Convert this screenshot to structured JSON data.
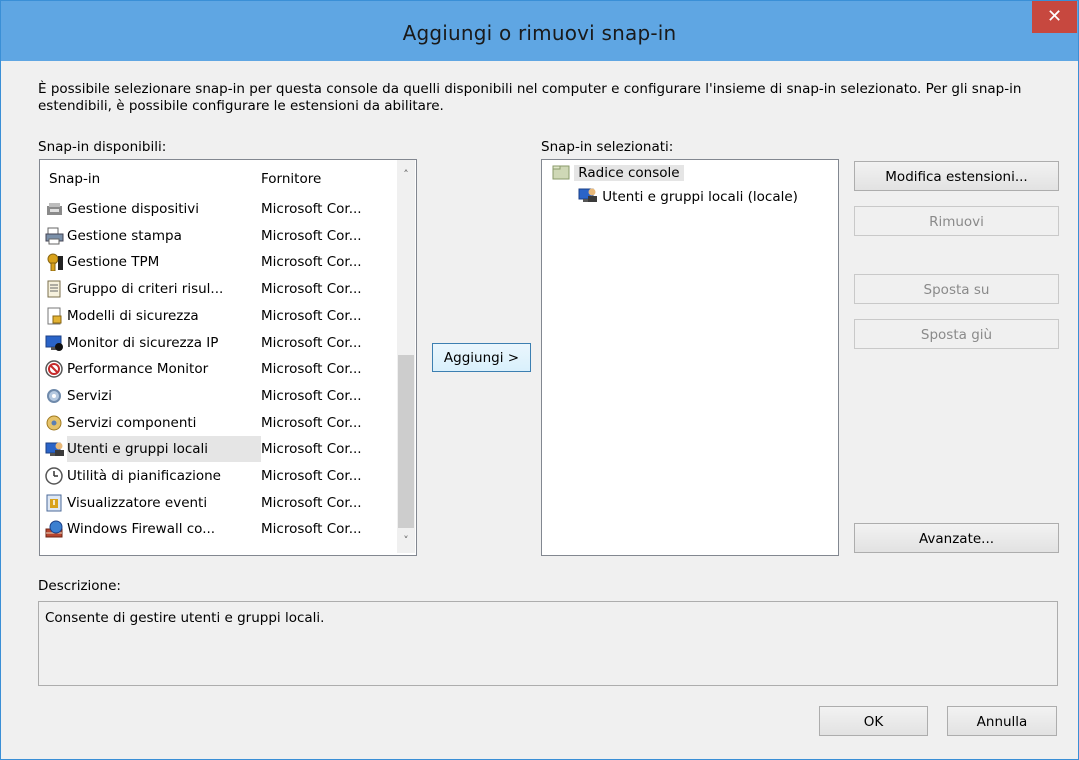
{
  "window": {
    "title": "Aggiungi o rimuovi snap-in",
    "close_glyph": "✕"
  },
  "intro_text": "È possibile selezionare snap-in per questa console da quelli disponibili nel computer e configurare l'insieme di snap-in selezionato. Per gli snap-in estendibili, è possibile configurare le estensioni da abilitare.",
  "available": {
    "label": "Snap-in disponibili:",
    "columns": [
      "Snap-in",
      "Fornitore"
    ],
    "items": [
      {
        "name": "Gestione dispositivi",
        "vendor": "Microsoft Cor...",
        "icon": "device-manager-icon",
        "selected": false
      },
      {
        "name": "Gestione stampa",
        "vendor": "Microsoft Cor...",
        "icon": "print-management-icon",
        "selected": false
      },
      {
        "name": "Gestione TPM",
        "vendor": "Microsoft Cor...",
        "icon": "tpm-key-icon",
        "selected": false
      },
      {
        "name": "Gruppo di criteri risul...",
        "vendor": "Microsoft Cor...",
        "icon": "policy-document-icon",
        "selected": false
      },
      {
        "name": "Modelli di sicurezza",
        "vendor": "Microsoft Cor...",
        "icon": "security-template-icon",
        "selected": false
      },
      {
        "name": "Monitor di sicurezza IP",
        "vendor": "Microsoft Cor...",
        "icon": "ip-security-monitor-icon",
        "selected": false
      },
      {
        "name": "Performance Monitor",
        "vendor": "Microsoft Cor...",
        "icon": "performance-monitor-icon",
        "selected": false
      },
      {
        "name": "Servizi",
        "vendor": "Microsoft Cor...",
        "icon": "services-gear-icon",
        "selected": false
      },
      {
        "name": "Servizi componenti",
        "vendor": "Microsoft Cor...",
        "icon": "component-services-icon",
        "selected": false
      },
      {
        "name": "Utenti e gruppi locali",
        "vendor": "Microsoft Cor...",
        "icon": "local-users-icon",
        "selected": true
      },
      {
        "name": "Utilità di pianificazione",
        "vendor": "Microsoft Cor...",
        "icon": "task-scheduler-clock-icon",
        "selected": false
      },
      {
        "name": "Visualizzatore eventi",
        "vendor": "Microsoft Cor...",
        "icon": "event-viewer-icon",
        "selected": false
      },
      {
        "name": "Windows Firewall co...",
        "vendor": "Microsoft Cor...",
        "icon": "firewall-icon",
        "selected": false
      }
    ]
  },
  "add_button": "Aggiungi >",
  "selected_snapins": {
    "label": "Snap-in selezionati:",
    "root": "Radice console",
    "child": "Utenti e gruppi locali (locale)"
  },
  "buttons": {
    "edit_extensions": "Modifica estensioni...",
    "remove": "Rimuovi",
    "move_up": "Sposta su",
    "move_down": "Sposta giù",
    "advanced": "Avanzate...",
    "ok": "OK",
    "cancel": "Annulla"
  },
  "description": {
    "label": "Descrizione:",
    "text": "Consente di gestire utenti e gruppi locali."
  },
  "colors": {
    "titlebar": "#5fa6e3",
    "close": "#c7483f",
    "selection": "#e5e5e5"
  }
}
